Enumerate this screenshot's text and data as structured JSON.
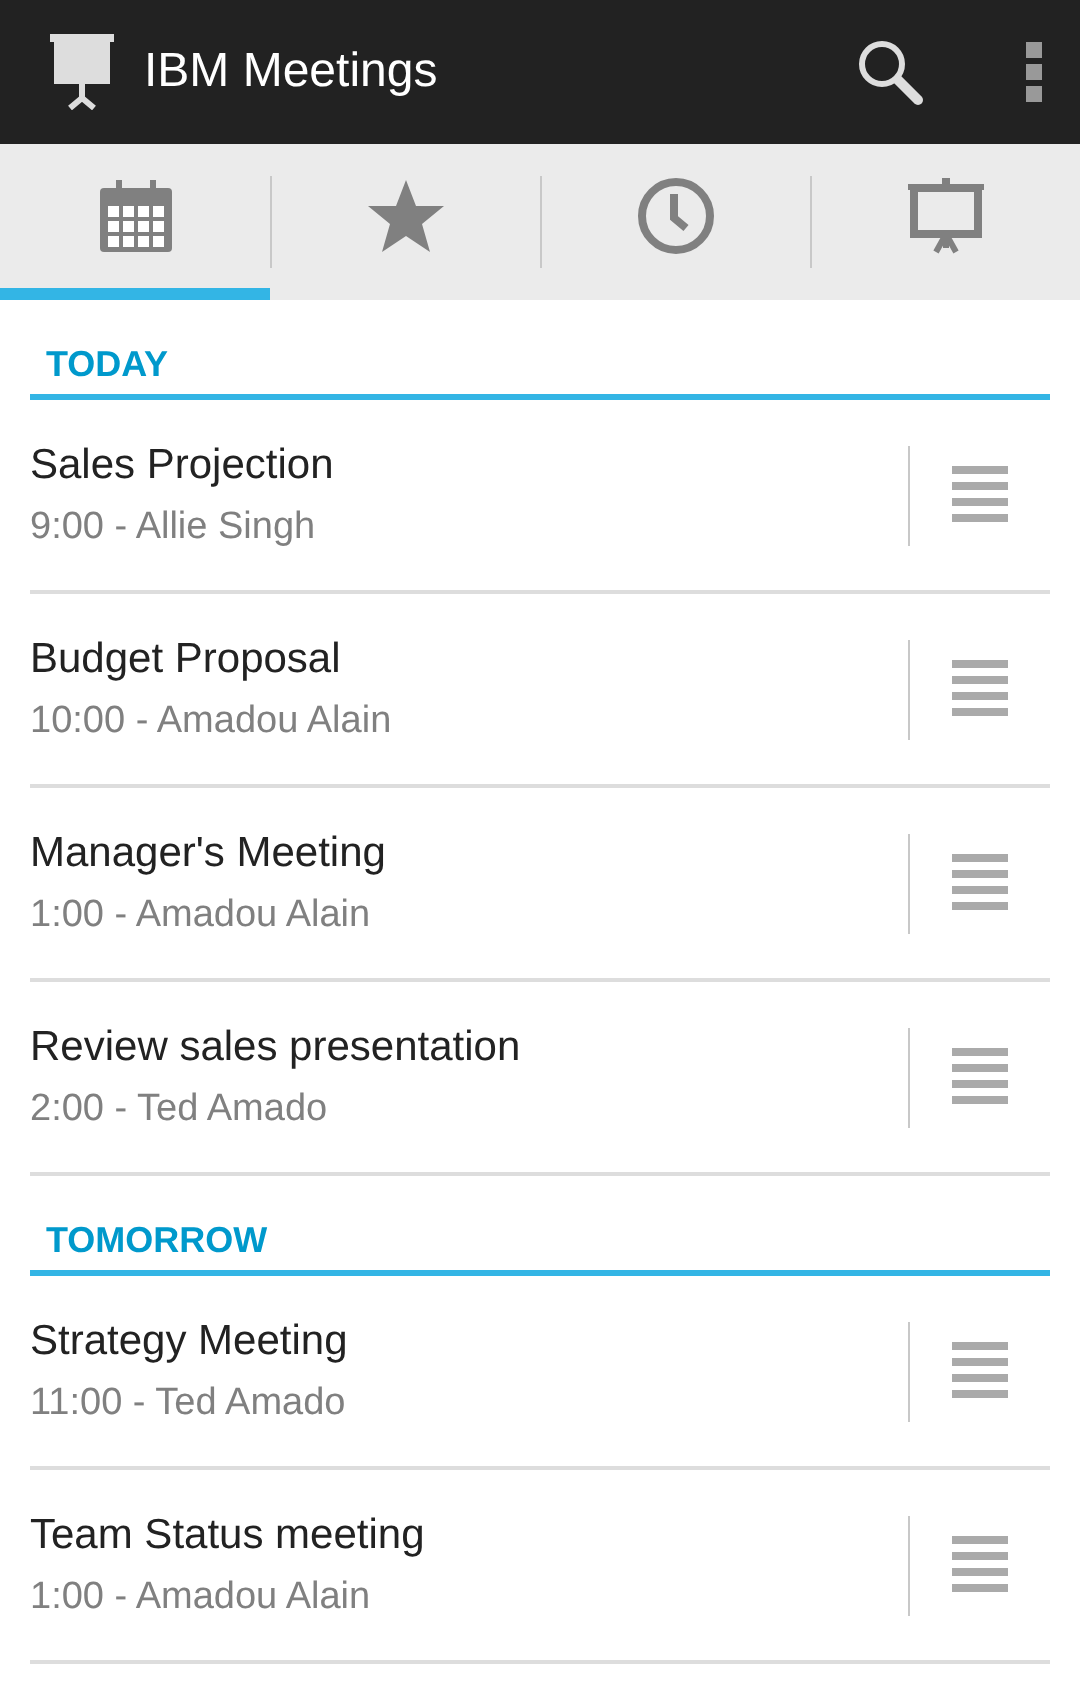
{
  "app_bar": {
    "title": "IBM Meetings"
  },
  "tabs": [
    {
      "kind": "calendar",
      "selected": true
    },
    {
      "kind": "star",
      "selected": false
    },
    {
      "kind": "clock",
      "selected": false
    },
    {
      "kind": "presentation",
      "selected": false
    }
  ],
  "sections": [
    {
      "header": "TODAY",
      "meetings": [
        {
          "title": "Sales Projection",
          "detail": "9:00 - Allie Singh"
        },
        {
          "title": "Budget Proposal",
          "detail": "10:00 - Amadou Alain"
        },
        {
          "title": "Manager's Meeting",
          "detail": "1:00 - Amadou Alain"
        },
        {
          "title": "Review sales presentation",
          "detail": "2:00 - Ted Amado"
        }
      ]
    },
    {
      "header": "TOMORROW",
      "meetings": [
        {
          "title": "Strategy Meeting",
          "detail": "11:00 - Ted Amado"
        },
        {
          "title": "Team Status meeting",
          "detail": "1:00 - Amadou Alain"
        }
      ]
    }
  ]
}
